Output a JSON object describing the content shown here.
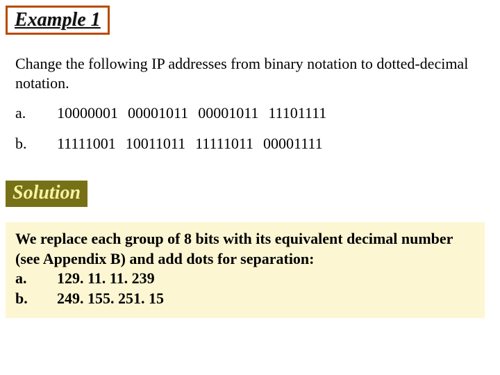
{
  "header": {
    "example_label": "Example 1"
  },
  "prompt": "Change the following IP addresses from binary notation to dotted-decimal notation.",
  "items": [
    {
      "label": "a.",
      "octets": [
        "10000001",
        "00001011",
        "00001011",
        "11101111"
      ]
    },
    {
      "label": "b.",
      "octets": [
        "11111001",
        "10011011",
        "11111011",
        "00001111"
      ]
    }
  ],
  "solution_label": "Solution",
  "answer": {
    "intro": "We replace each group of 8 bits with its equivalent decimal number (see Appendix B) and add dots for separation:",
    "results": [
      {
        "label": "a.",
        "value": "129. 11. 11. 239"
      },
      {
        "label": "b.",
        "value": "249. 155. 251. 15"
      }
    ]
  }
}
